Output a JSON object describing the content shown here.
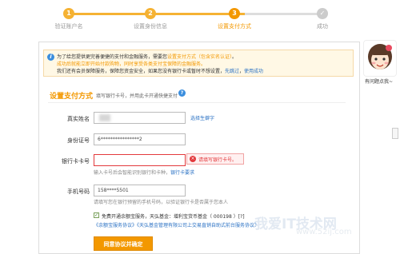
{
  "steps": [
    {
      "number": "1",
      "label": "验证账户名",
      "state": "done"
    },
    {
      "number": "2",
      "label": "设置身份信息",
      "state": "done"
    },
    {
      "number": "3",
      "label": "设置支付方式",
      "state": "active"
    },
    {
      "number": "",
      "label": "成功",
      "state": "pending"
    }
  ],
  "colors": {
    "accent": "#f39800",
    "link": "#2b72c4",
    "error": "#e3393c",
    "done": "#f5b233",
    "pending": "#cccccc"
  },
  "notice": {
    "line1_a": "为了给您提供更完善便捷的支付和金融服务，需要您",
    "line1_em": "设置支付方式（包含实名认证）",
    "line1_b": "。",
    "line2": "成功后就能立即开始付款购物，同时享受各类支付宝保障的金融服务。",
    "line3_a": "我们还有会员保障服务，保障您资金安全，如果您没有银行卡或暂时不想设置，",
    "line3_link1": "先跳过",
    "line3_sep": "，",
    "line3_link2": "使用成功"
  },
  "section": {
    "title": "设置支付方式",
    "hint": "填写银行卡号，并用此卡开通快捷支付",
    "help_glyph": "?"
  },
  "form": {
    "name_label": "真实姓名",
    "name_link": "选择生僻字",
    "id_label": "身份证号",
    "id_value": "6****************2",
    "card_label": "银行卡卡号",
    "card_value": "",
    "card_error": "请填写银行卡号。",
    "card_hint": "输入卡号后会智能识别银行和卡种，",
    "card_hint_link": "银行卡要求",
    "phone_label": "手机号码",
    "phone_value": "158****5501",
    "phone_hint": "请填写您在银行预留的手机号码，以验证银行卡是否属于您本人",
    "agree_text": "免费开通余额宝服务，天弘基金：增利宝货币基金（ 000198 ）[?]",
    "agree_links": "《余额宝服务协议》《天弘基金管理有限公司上交易直销自助式前台服务协议》",
    "submit_label": "同意协议并确定"
  },
  "sidebar": {
    "help_label": "有问题点我~"
  },
  "watermark": {
    "main": "我爱IT技术网",
    "sub": "www.52ij.com"
  }
}
